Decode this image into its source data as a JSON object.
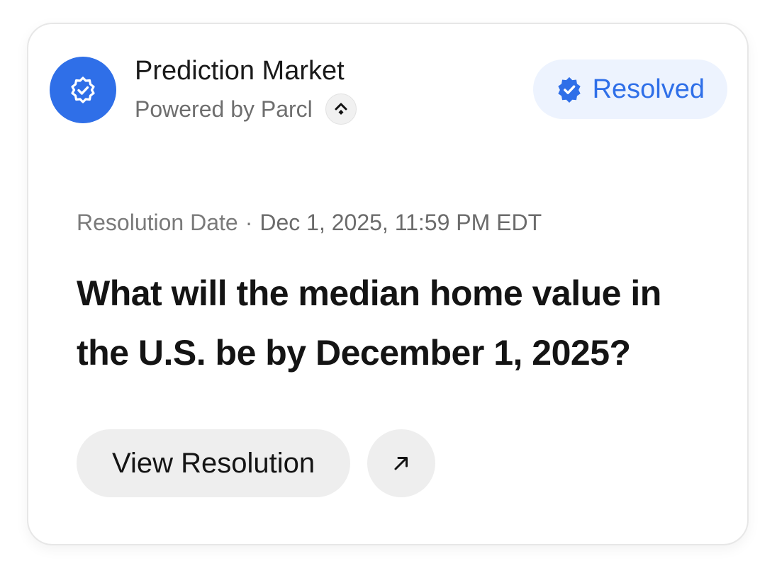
{
  "card": {
    "title": "Prediction Market",
    "subtitle": "Powered by Parcl",
    "status": {
      "label": "Resolved",
      "icon": "verified-badge-icon",
      "color": "#2f6fe8",
      "background": "#edf3fe"
    },
    "meta": {
      "label": "Resolution Date",
      "separator": "·",
      "value": "Dec 1, 2025, 11:59 PM EDT"
    },
    "question": "What will the median home value in the U.S. be by December 1, 2025?",
    "actions": {
      "primary_label": "View Resolution",
      "secondary_icon": "arrow-up-right-icon"
    },
    "logo_icon": "verified-badge-icon",
    "accent": "#2f6fe8"
  }
}
